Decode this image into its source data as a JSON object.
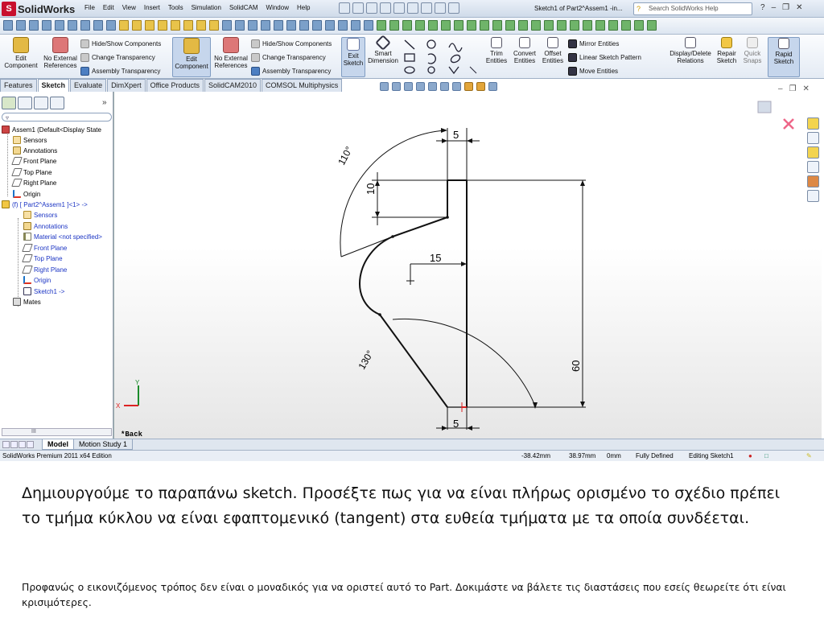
{
  "app": {
    "logo_text": "SolidWorks",
    "menu": [
      "File",
      "Edit",
      "View",
      "Insert",
      "Tools",
      "Simulation",
      "SolidCAM",
      "Window",
      "Help"
    ],
    "doc_title": "Sketch1 of Part2^Assem1 -in...",
    "search_placeholder": "Search SolidWorks Help",
    "help_label": "?"
  },
  "command_manager": {
    "edit_component": "Edit Component",
    "no_external_refs": "No External References",
    "hide_show": "Hide/Show Components",
    "change_transparency": "Change Transparency",
    "assembly_transparency": "Assembly Transparency",
    "exit_sketch": "Exit Sketch",
    "smart_dimension": "Smart Dimension",
    "trim_entities": "Trim Entities",
    "convert_entities": "Convert Entities",
    "offset_entities": "Offset Entities",
    "mirror_entities": "Mirror Entities",
    "linear_sketch_pattern": "Linear Sketch Pattern",
    "move_entities": "Move Entities",
    "display_delete_relations": "Display/Delete Relations",
    "repair_sketch": "Repair Sketch",
    "quick_snaps": "Quick Snaps",
    "rapid_sketch": "Rapid Sketch"
  },
  "tabs": [
    "Features",
    "Sketch",
    "Evaluate",
    "DimXpert",
    "Office Products",
    "SolidCAM2010",
    "COMSOL Multiphysics"
  ],
  "active_tab": "Sketch",
  "feature_tree": {
    "root": "Assem1  (Default<Display State",
    "items": [
      "Sensors",
      "Annotations",
      "Front Plane",
      "Top Plane",
      "Right Plane",
      "Origin",
      "(f) [ Part2^Assem1 ]<1> ->",
      "Sensors",
      "Annotations",
      "Material <not specified>",
      "Front Plane",
      "Top Plane",
      "Right Plane",
      "Origin",
      "Sketch1 ->",
      "Mates"
    ],
    "scroll_label": "III"
  },
  "sketch": {
    "dims": {
      "top_width": "5",
      "height_10": "10",
      "mid_width": "15",
      "height_60": "60",
      "bottom_width": "5",
      "angle_110": "110°",
      "angle_130": "130°"
    },
    "view_label": "*Back",
    "triad_x": "X",
    "triad_y": "Y"
  },
  "bottom_tabs": [
    "Model",
    "Motion Study 1"
  ],
  "status": {
    "edition": "SolidWorks Premium 2011 x64 Edition",
    "x": "-38.42mm",
    "y": "38.97mm",
    "z": "0mm",
    "state": "Fully Defined",
    "mode": "Editing Sketch1"
  },
  "caption": "Δημιουργούμε το παραπάνω sketch. Προσέξτε πως για να είναι πλήρως ορισμένο το σχέδιο πρέπει το τμήμα κύκλου να είναι εφαπτομενικό (tangent) στα ευθεία τμήματα με τα οποία συνδέεται.",
  "note": "Προφανώς ο εικονιζόμενος τρόπος δεν είναι ο μοναδικός για να οριστεί αυτό το Part. Δοκιμάστε να βάλετε τις διαστάσεις που εσείς θεωρείτε ότι είναι κρισιμότερες."
}
